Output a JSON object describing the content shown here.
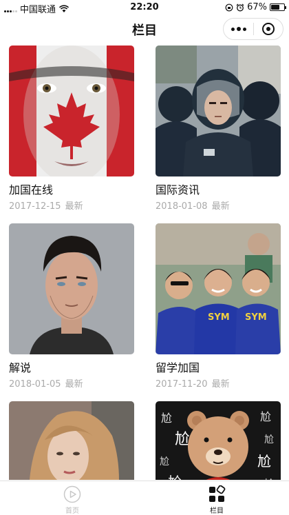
{
  "status_bar": {
    "carrier": "中国联通",
    "time": "22:20",
    "battery_text": "67%",
    "battery_level": 0.67
  },
  "nav": {
    "title": "栏目"
  },
  "cards": [
    {
      "title": "加国在线",
      "date": "2017-12-15",
      "tag": "最新",
      "image": "canada-flag-face"
    },
    {
      "title": "国际资讯",
      "date": "2018-01-08",
      "tag": "最新",
      "image": "riot-police"
    },
    {
      "title": "解说",
      "date": "2018-01-05",
      "tag": "最新",
      "image": "man-portrait"
    },
    {
      "title": "留学加国",
      "date": "2017-11-20",
      "tag": "最新",
      "image": "students-group"
    },
    {
      "title": "",
      "date": "",
      "tag": "",
      "image": "woman-portrait"
    },
    {
      "title": "",
      "date": "",
      "tag": "",
      "image": "bear-cartoon",
      "image_text": [
        "尬",
        "尬",
        "尬",
        "尬",
        "尬",
        "尬",
        "尬",
        "尬"
      ]
    }
  ],
  "tabs": [
    {
      "label": "首页",
      "icon": "play-circle-icon",
      "active": false
    },
    {
      "label": "栏目",
      "icon": "grid-icon",
      "active": true
    }
  ]
}
